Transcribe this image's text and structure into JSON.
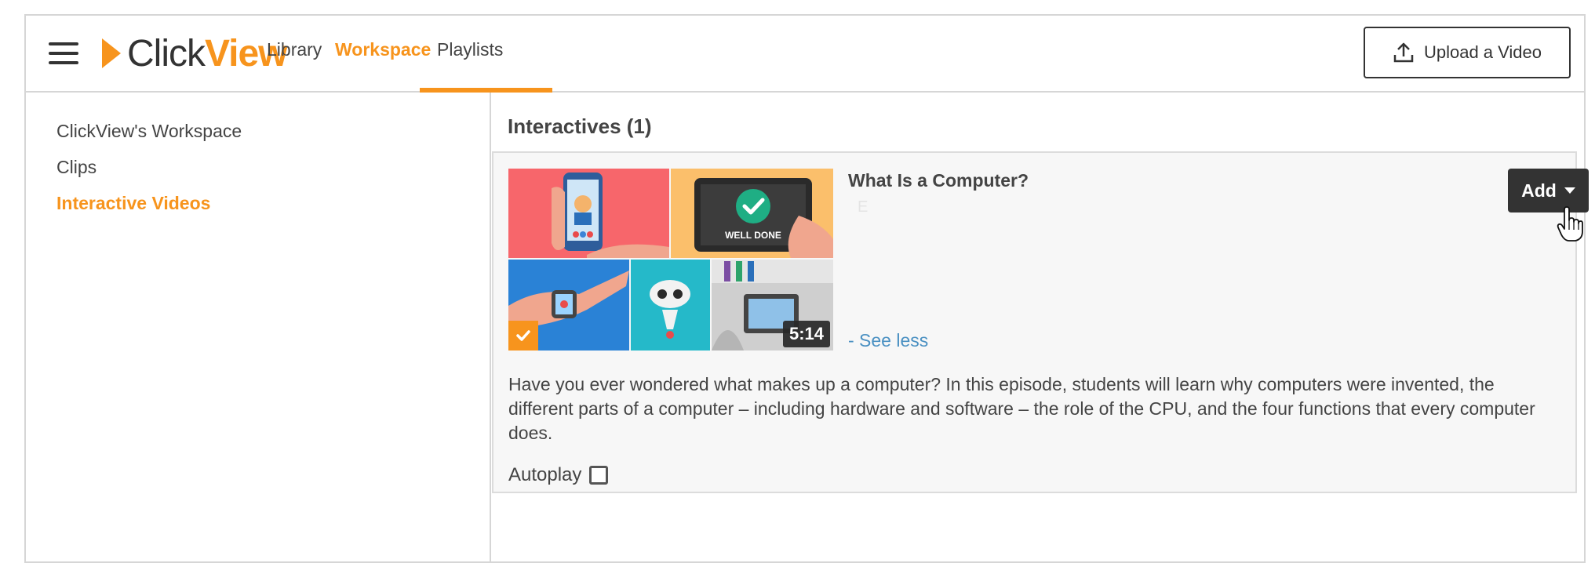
{
  "header": {
    "logo": {
      "part1": "Click",
      "part2": "View"
    },
    "tabs": [
      {
        "label": "Library"
      },
      {
        "label": "Workspace",
        "active": true
      },
      {
        "label": "Playlists"
      }
    ],
    "upload_label": "Upload a Video"
  },
  "sidebar": {
    "items": [
      {
        "label": "ClickView's Workspace"
      },
      {
        "label": "Clips"
      },
      {
        "label": "Interactive Videos",
        "active": true
      }
    ]
  },
  "main": {
    "section_title": "Interactives (1)",
    "video": {
      "title": "What Is a Computer?",
      "faint_text": "E",
      "duration": "5:14",
      "see_less": "- See less",
      "add_label": "Add",
      "description": "Have you ever wondered what makes up a computer? In this episode, students will learn why computers were invented, the different parts of a computer – including hardware and software – the role of the CPU, and the four functions that every computer does.",
      "autoplay_label": "Autoplay",
      "autoplay_checked": false,
      "thumbnail_text": "WELL DONE"
    }
  },
  "colors": {
    "accent": "#f7941d",
    "link": "#4a90c2",
    "button_dark": "#333333"
  }
}
